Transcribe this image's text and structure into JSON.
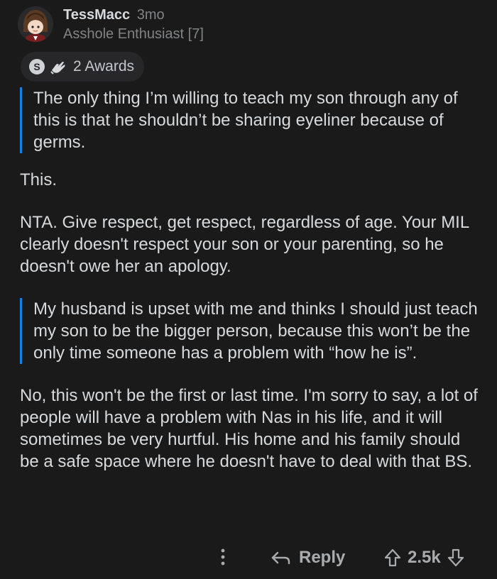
{
  "comment": {
    "author": "TessMacc",
    "age": "3mo",
    "flair": "Asshole Enthusiast [7]",
    "awards": {
      "label": "2 Awards",
      "silver_badge_text": "S",
      "icons": [
        "silver-award-icon",
        "helpful-hands-award-icon"
      ]
    },
    "blocks": [
      {
        "type": "quote",
        "text": "The only thing I’m willing to teach my son through any of this is that he shouldn’t be sharing eyeliner because of germs."
      },
      {
        "type": "paragraph",
        "text": "This."
      },
      {
        "type": "paragraph",
        "text": "NTA. Give respect, get respect, regardless of age. Your MIL clearly doesn't respect your son or your parenting, so he doesn't owe her an apology."
      },
      {
        "type": "quote",
        "text": "My husband is upset with me and thinks I should just teach my son to be the bigger person, because this won’t be the only time someone has a problem with “how he is”."
      },
      {
        "type": "paragraph",
        "text": "No, this won't be the first or last time. I'm sorry to say, a lot of people will have a problem with Nas in his life, and it will sometimes be very hurtful. His home and his family should be a safe space where he doesn't have to deal with that BS."
      }
    ],
    "actions": {
      "reply_label": "Reply",
      "score": "2.5k"
    }
  },
  "colors": {
    "background": "#1a1a1b",
    "text": "#d7dadc",
    "muted": "#818384",
    "quote_bar": "#1a7fe3",
    "pill": "#272729"
  }
}
